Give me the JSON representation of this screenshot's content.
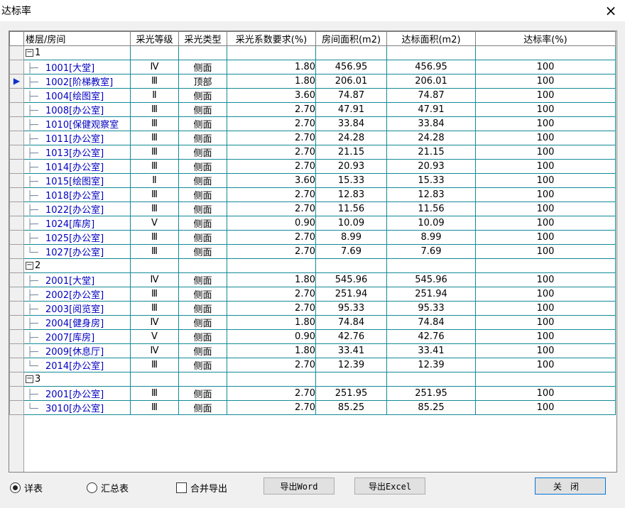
{
  "window": {
    "title": "达标率",
    "close_icon": "×"
  },
  "columns": [
    "楼层/房间",
    "采光等级",
    "采光类型",
    "采光系数要求(%)",
    "房间面积(m2)",
    "达标面积(m2)",
    "达标率(%)"
  ],
  "groups": [
    {
      "floor": "1",
      "rows": [
        {
          "name": "1001[大堂]",
          "grade": "Ⅳ",
          "type": "侧面",
          "req": "1.80",
          "area": "456.95",
          "ok": "456.95",
          "rate": "100"
        },
        {
          "name": "1002[阶梯教室]",
          "grade": "Ⅲ",
          "type": "顶部",
          "req": "1.80",
          "area": "206.01",
          "ok": "206.01",
          "rate": "100"
        },
        {
          "name": "1004[绘图室]",
          "grade": "Ⅱ",
          "type": "侧面",
          "req": "3.60",
          "area": "74.87",
          "ok": "74.87",
          "rate": "100"
        },
        {
          "name": "1008[办公室]",
          "grade": "Ⅲ",
          "type": "侧面",
          "req": "2.70",
          "area": "47.91",
          "ok": "47.91",
          "rate": "100"
        },
        {
          "name": "1010[保健观察室",
          "grade": "Ⅲ",
          "type": "侧面",
          "req": "2.70",
          "area": "33.84",
          "ok": "33.84",
          "rate": "100"
        },
        {
          "name": "1011[办公室]",
          "grade": "Ⅲ",
          "type": "侧面",
          "req": "2.70",
          "area": "24.28",
          "ok": "24.28",
          "rate": "100"
        },
        {
          "name": "1013[办公室]",
          "grade": "Ⅲ",
          "type": "侧面",
          "req": "2.70",
          "area": "21.15",
          "ok": "21.15",
          "rate": "100"
        },
        {
          "name": "1014[办公室]",
          "grade": "Ⅲ",
          "type": "侧面",
          "req": "2.70",
          "area": "20.93",
          "ok": "20.93",
          "rate": "100"
        },
        {
          "name": "1015[绘图室]",
          "grade": "Ⅱ",
          "type": "侧面",
          "req": "3.60",
          "area": "15.33",
          "ok": "15.33",
          "rate": "100"
        },
        {
          "name": "1018[办公室]",
          "grade": "Ⅲ",
          "type": "侧面",
          "req": "2.70",
          "area": "12.83",
          "ok": "12.83",
          "rate": "100"
        },
        {
          "name": "1022[办公室]",
          "grade": "Ⅲ",
          "type": "侧面",
          "req": "2.70",
          "area": "11.56",
          "ok": "11.56",
          "rate": "100"
        },
        {
          "name": "1024[库房]",
          "grade": "Ⅴ",
          "type": "侧面",
          "req": "0.90",
          "area": "10.09",
          "ok": "10.09",
          "rate": "100"
        },
        {
          "name": "1025[办公室]",
          "grade": "Ⅲ",
          "type": "侧面",
          "req": "2.70",
          "area": "8.99",
          "ok": "8.99",
          "rate": "100"
        },
        {
          "name": "1027[办公室]",
          "grade": "Ⅲ",
          "type": "侧面",
          "req": "2.70",
          "area": "7.69",
          "ok": "7.69",
          "rate": "100"
        }
      ]
    },
    {
      "floor": "2",
      "rows": [
        {
          "name": "2001[大堂]",
          "grade": "Ⅳ",
          "type": "侧面",
          "req": "1.80",
          "area": "545.96",
          "ok": "545.96",
          "rate": "100"
        },
        {
          "name": "2002[办公室]",
          "grade": "Ⅲ",
          "type": "侧面",
          "req": "2.70",
          "area": "251.94",
          "ok": "251.94",
          "rate": "100"
        },
        {
          "name": "2003[阅览室]",
          "grade": "Ⅲ",
          "type": "侧面",
          "req": "2.70",
          "area": "95.33",
          "ok": "95.33",
          "rate": "100"
        },
        {
          "name": "2004[健身房]",
          "grade": "Ⅳ",
          "type": "侧面",
          "req": "1.80",
          "area": "74.84",
          "ok": "74.84",
          "rate": "100"
        },
        {
          "name": "2007[库房]",
          "grade": "Ⅴ",
          "type": "侧面",
          "req": "0.90",
          "area": "42.76",
          "ok": "42.76",
          "rate": "100"
        },
        {
          "name": "2009[休息厅]",
          "grade": "Ⅳ",
          "type": "侧面",
          "req": "1.80",
          "area": "33.41",
          "ok": "33.41",
          "rate": "100"
        },
        {
          "name": "2014[办公室]",
          "grade": "Ⅲ",
          "type": "侧面",
          "req": "2.70",
          "area": "12.39",
          "ok": "12.39",
          "rate": "100"
        }
      ]
    },
    {
      "floor": "3",
      "rows": [
        {
          "name": "2001[办公室]",
          "grade": "Ⅲ",
          "type": "侧面",
          "req": "2.70",
          "area": "251.95",
          "ok": "251.95",
          "rate": "100"
        },
        {
          "name": "3010[办公室]",
          "grade": "Ⅲ",
          "type": "侧面",
          "req": "2.70",
          "area": "85.25",
          "ok": "85.25",
          "rate": "100"
        }
      ]
    }
  ],
  "selected_row": "1002[阶梯教室]",
  "controls": {
    "radio_detail": "详表",
    "radio_summary": "汇总表",
    "merge_export": "合并导出",
    "export_word": "导出Word",
    "export_excel": "导出Excel",
    "close": "关闭"
  }
}
